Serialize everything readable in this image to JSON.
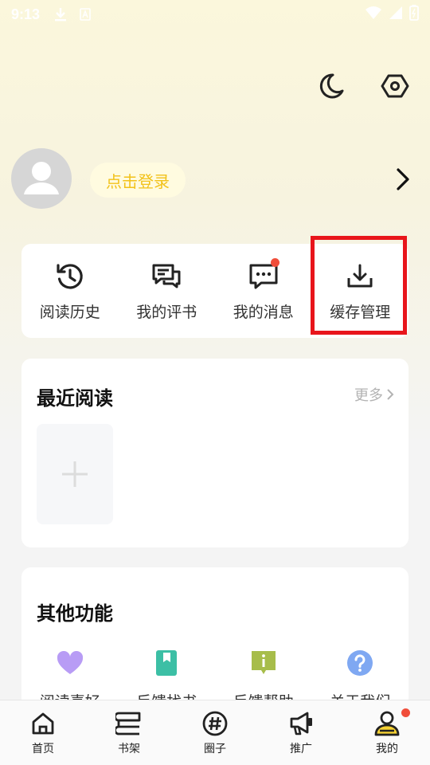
{
  "status_bar": {
    "time": "9:13"
  },
  "profile": {
    "login_label": "点击登录"
  },
  "quick_actions": [
    {
      "label": "阅读历史",
      "icon": "history-icon"
    },
    {
      "label": "我的评书",
      "icon": "comments-icon"
    },
    {
      "label": "我的消息",
      "icon": "message-icon"
    },
    {
      "label": "缓存管理",
      "icon": "download-icon"
    }
  ],
  "recent": {
    "title": "最近阅读",
    "more": "更多"
  },
  "other": {
    "title": "其他功能",
    "items": [
      {
        "label": "阅读喜好",
        "icon": "heart-icon",
        "color": "#b89cf5"
      },
      {
        "label": "反馈找书",
        "icon": "bookmark-book-icon",
        "color": "#3cbfa5"
      },
      {
        "label": "反馈帮助",
        "icon": "info-message-icon",
        "color": "#a7bd4a"
      },
      {
        "label": "关于我们",
        "icon": "question-icon",
        "color": "#7fa8f2"
      }
    ]
  },
  "bottom_nav": [
    {
      "label": "首页",
      "icon": "home-icon"
    },
    {
      "label": "书架",
      "icon": "bookshelf-icon"
    },
    {
      "label": "圈子",
      "icon": "hashtag-icon"
    },
    {
      "label": "推广",
      "icon": "megaphone-icon"
    },
    {
      "label": "我的",
      "icon": "profile-icon"
    }
  ],
  "colors": {
    "accent": "#f2c21a",
    "badge": "#f04d3a",
    "highlight": "#e8151b"
  }
}
